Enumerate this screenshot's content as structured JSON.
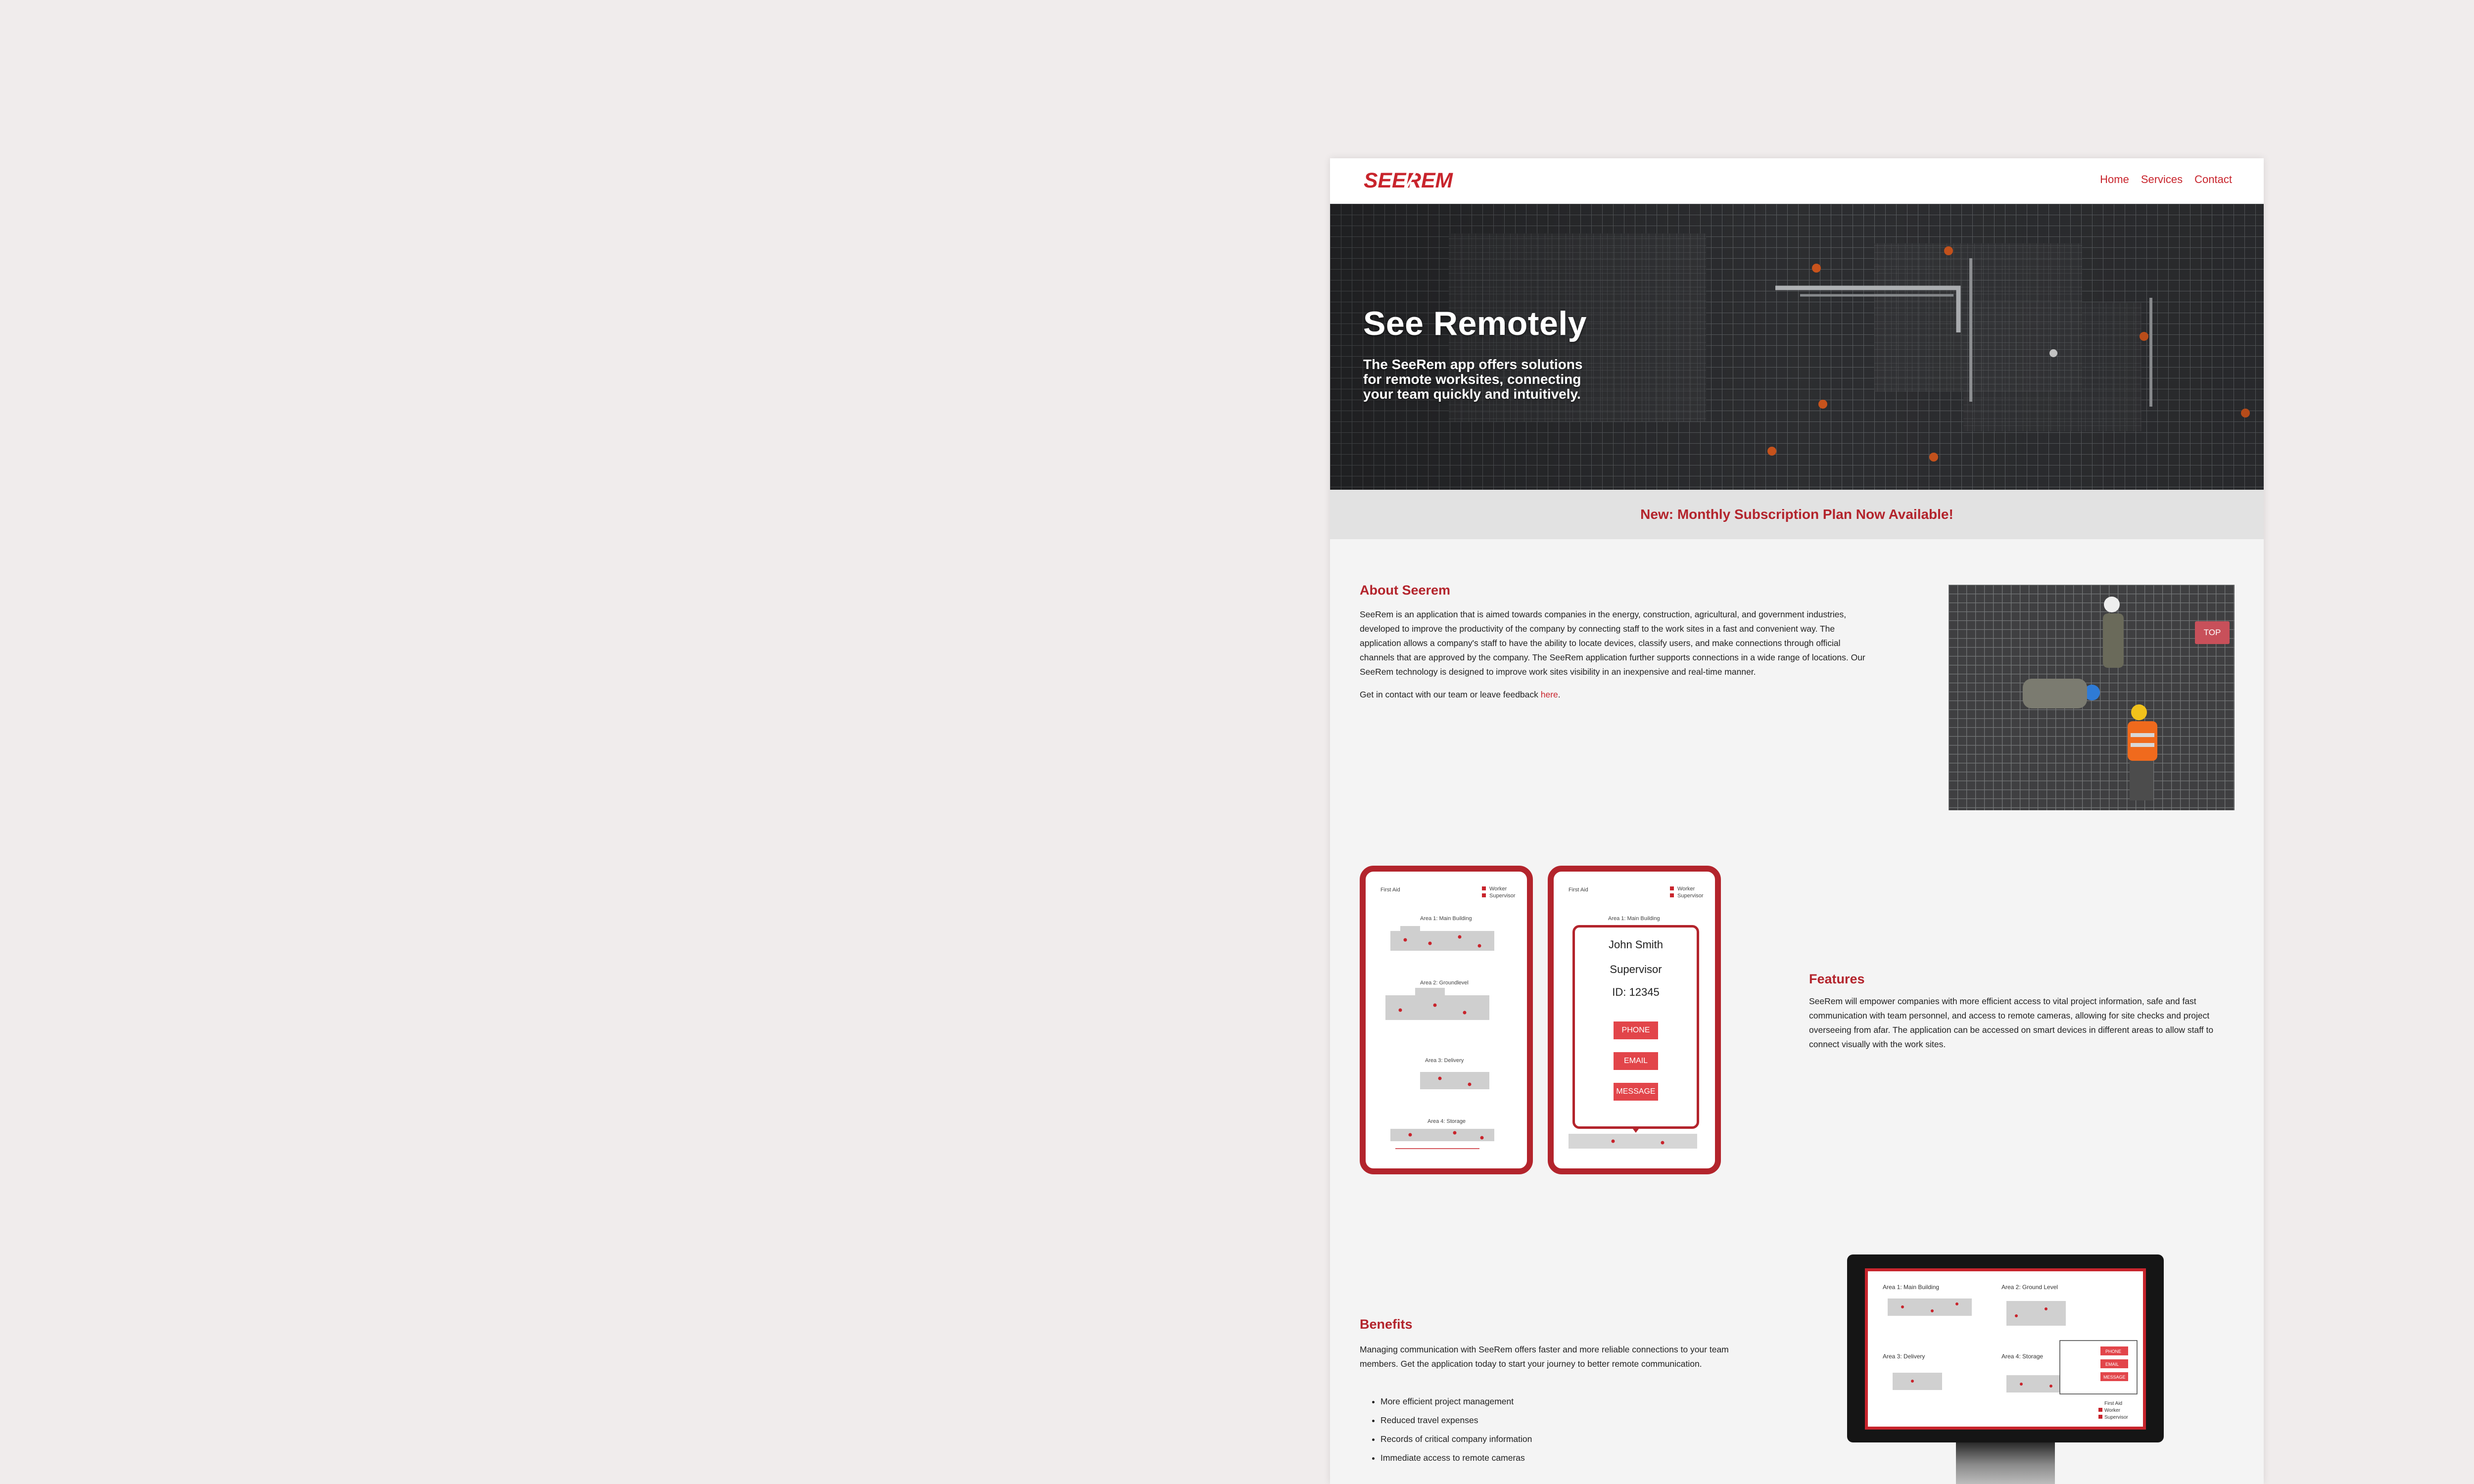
{
  "brand": {
    "logo_text": "SEEREM",
    "accent": "#c8242c"
  },
  "nav": {
    "items": [
      "Home",
      "Services",
      "Contact"
    ]
  },
  "hero": {
    "title": "See Remotely",
    "subtitle": "The SeeRem app offers solutions for remote worksites, connecting your team quickly and intuitively."
  },
  "banner": {
    "text": "New: Monthly Subscription Plan Now Available!"
  },
  "about": {
    "title": "About Seerem",
    "body": "SeeRem is an application that is aimed towards companies in the energy, construction, agricultural, and government industries, developed to improve the productivity of the company by connecting staff to the work sites in a fast and convenient way. The application allows a company's staff to have the ability to locate devices, classify users, and make connections through official channels that are approved by the company. The SeeRem application further supports connections in a wide range of locations. Our SeeRem technology is designed to improve work sites visibility in an inexpensive and real-time manner.",
    "contact_prefix": "Get in contact with our team or leave feedback ",
    "contact_link": "here",
    "contact_suffix": ".",
    "top_button": "TOP"
  },
  "phones": {
    "legend": {
      "first_aid": "First Aid",
      "worker": "Worker",
      "supervisor": "Supervisor"
    },
    "areas": [
      "Area 1: Main Building",
      "Area 2: Groundlevel",
      "Area 3: Delivery",
      "Area 4: Storage"
    ],
    "contact_card": {
      "name": "John Smith",
      "role": "Supervisor",
      "id": "ID: 12345",
      "buttons": [
        "PHONE",
        "EMAIL",
        "MESSAGE"
      ]
    }
  },
  "features": {
    "title": "Features",
    "body": "SeeRem will empower companies with more efficient access to vital project information, safe and fast communication with team personnel, and access to remote cameras, allowing for site checks and project overseeing from afar. The application can be accessed on smart devices in different areas to allow staff to connect visually with the work sites."
  },
  "monitor": {
    "areas": [
      "Area 1: Main Building",
      "Area 2: Ground Level",
      "Area 3: Delivery",
      "Area 4: Storage"
    ],
    "popup_buttons": [
      "PHONE",
      "EMAIL",
      "MESSAGE"
    ],
    "legend": {
      "first_aid": "First Aid",
      "worker": "Worker",
      "supervisor": "Supervisor"
    }
  },
  "benefits": {
    "title": "Benefits",
    "body": "Managing communication with SeeRem offers faster and more reliable connections to your team members. Get the application today to start your journey to better remote communication.",
    "items": [
      "More efficient project management",
      "Reduced travel expenses",
      "Records of critical company information",
      "Immediate access to remote cameras"
    ]
  }
}
